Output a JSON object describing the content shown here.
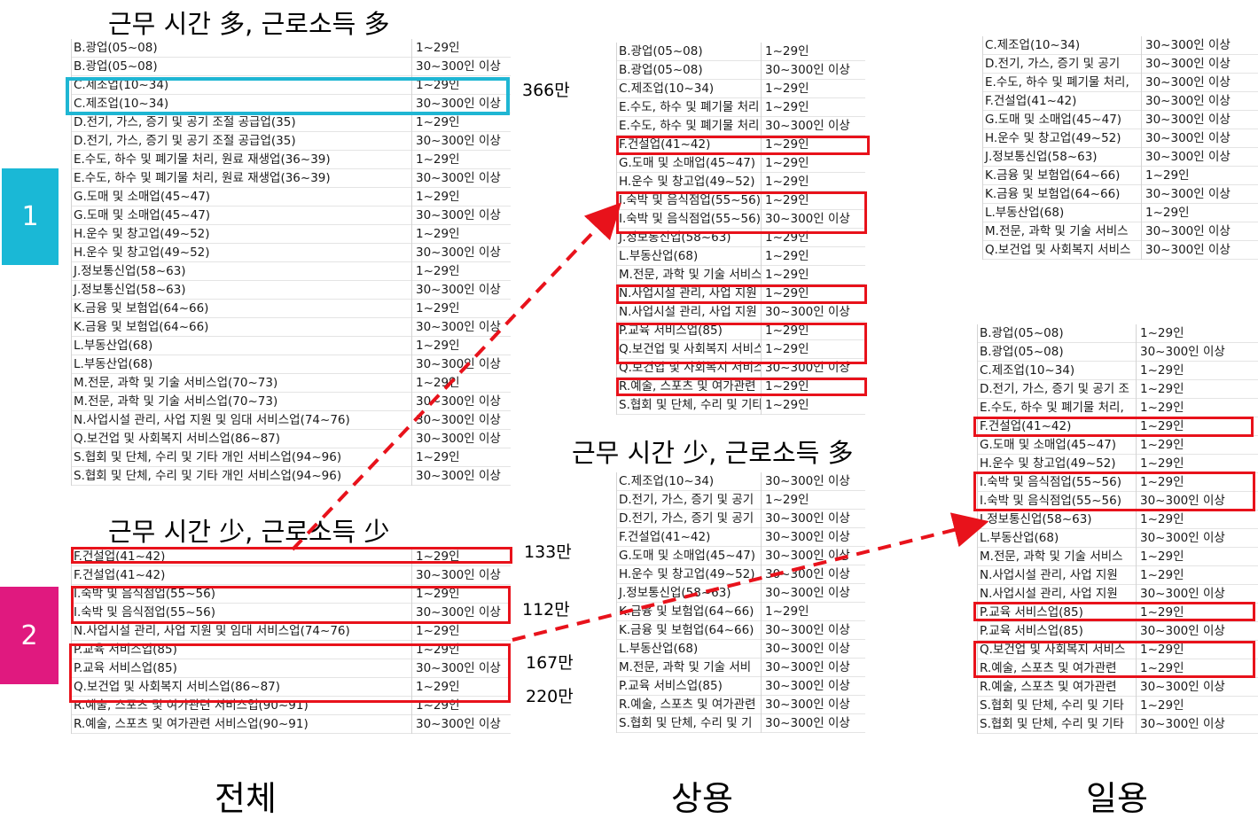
{
  "headings": {
    "top_left": "근무 시간 多, 근로소득 多",
    "bottom_left": "근무 시간 少, 근로소득 少",
    "center": "근무 시간 少, 근로소득 多"
  },
  "badges": {
    "one": {
      "label": "1",
      "color": "#1ab8d6"
    },
    "two": {
      "label": "2",
      "color": "#e0197f"
    }
  },
  "annotations": {
    "a366": "366만",
    "a133": "133만",
    "a112": "112만",
    "a167": "167만",
    "a220": "220만"
  },
  "footer": {
    "total": "전체",
    "regular": "상용",
    "daily": "일용"
  },
  "colors": {
    "highlight_red": "#e8121b",
    "highlight_cyan": "#1fb6d3"
  },
  "tables": {
    "t1": [
      [
        "B.광업(05~08)",
        "1~29인"
      ],
      [
        "B.광업(05~08)",
        "30~300인 이상"
      ],
      [
        "C.제조업(10~34)",
        "1~29인"
      ],
      [
        "C.제조업(10~34)",
        "30~300인 이상"
      ],
      [
        "D.전기, 가스, 증기 및 공기 조절 공급업(35)",
        "1~29인"
      ],
      [
        "D.전기, 가스, 증기 및 공기 조절 공급업(35)",
        "30~300인 이상"
      ],
      [
        "E.수도, 하수 및 폐기물 처리, 원료 재생업(36~39)",
        "1~29인"
      ],
      [
        "E.수도, 하수 및 폐기물 처리, 원료 재생업(36~39)",
        "30~300인 이상"
      ],
      [
        "G.도매 및 소매업(45~47)",
        "1~29인"
      ],
      [
        "G.도매 및 소매업(45~47)",
        "30~300인 이상"
      ],
      [
        "H.운수 및 창고업(49~52)",
        "1~29인"
      ],
      [
        "H.운수 및 창고업(49~52)",
        "30~300인 이상"
      ],
      [
        "J.정보통신업(58~63)",
        "1~29인"
      ],
      [
        "J.정보통신업(58~63)",
        "30~300인 이상"
      ],
      [
        "K.금융 및 보험업(64~66)",
        "1~29인"
      ],
      [
        "K.금융 및 보험업(64~66)",
        "30~300인 이상"
      ],
      [
        "L.부동산업(68)",
        "1~29인"
      ],
      [
        "L.부동산업(68)",
        "30~300인 이상"
      ],
      [
        "M.전문, 과학 및 기술 서비스업(70~73)",
        "1~29인"
      ],
      [
        "M.전문, 과학 및 기술 서비스업(70~73)",
        "30~300인 이상"
      ],
      [
        "N.사업시설 관리, 사업 지원 및 임대 서비스업(74~76)",
        "30~300인 이상"
      ],
      [
        "Q.보건업 및 사회복지 서비스업(86~87)",
        "30~300인 이상"
      ],
      [
        "S.협회 및 단체, 수리 및 기타 개인 서비스업(94~96)",
        "1~29인"
      ],
      [
        "S.협회 및 단체, 수리 및 기타 개인 서비스업(94~96)",
        "30~300인 이상"
      ]
    ],
    "t2": [
      [
        "F.건설업(41~42)",
        "1~29인"
      ],
      [
        "F.건설업(41~42)",
        "30~300인 이상"
      ],
      [
        "I.숙박 및 음식점업(55~56)",
        "1~29인"
      ],
      [
        "I.숙박 및 음식점업(55~56)",
        "30~300인 이상"
      ],
      [
        "N.사업시설 관리, 사업 지원 및 임대 서비스업(74~76)",
        "1~29인"
      ],
      [
        "P.교육 서비스업(85)",
        "1~29인"
      ],
      [
        "P.교육 서비스업(85)",
        "30~300인 이상"
      ],
      [
        "Q.보건업 및 사회복지 서비스업(86~87)",
        "1~29인"
      ],
      [
        "R.예술, 스포츠 및 여가관련 서비스업(90~91)",
        "1~29인"
      ],
      [
        "R.예술, 스포츠 및 여가관련 서비스업(90~91)",
        "30~300인 이상"
      ]
    ],
    "t3": [
      [
        "B.광업(05~08)",
        "1~29인"
      ],
      [
        "B.광업(05~08)",
        "30~300인 이상"
      ],
      [
        "C.제조업(10~34)",
        "1~29인"
      ],
      [
        "E.수도, 하수 및 폐기물 처리",
        "1~29인"
      ],
      [
        "E.수도, 하수 및 폐기물 처리",
        "30~300인 이상"
      ],
      [
        "F.건설업(41~42)",
        "1~29인"
      ],
      [
        "G.도매 및 소매업(45~47)",
        "1~29인"
      ],
      [
        "H.운수 및 창고업(49~52)",
        "1~29인"
      ],
      [
        "I.숙박 및 음식점업(55~56)",
        "1~29인"
      ],
      [
        "I.숙박 및 음식점업(55~56)",
        "30~300인 이상"
      ],
      [
        "J.정보통신업(58~63)",
        "1~29인"
      ],
      [
        "L.부동산업(68)",
        "1~29인"
      ],
      [
        "M.전문, 과학 및 기술 서비스",
        "1~29인"
      ],
      [
        "N.사업시설 관리, 사업 지원",
        "1~29인"
      ],
      [
        "N.사업시설 관리, 사업 지원",
        "30~300인 이상"
      ],
      [
        "P.교육 서비스업(85)",
        "1~29인"
      ],
      [
        "Q.보건업 및 사회복지 서비스",
        "1~29인"
      ],
      [
        "Q.보건업 및 사회복지 서비스",
        "30~300인 이상"
      ],
      [
        "R.예술, 스포츠 및 여가관련",
        "1~29인"
      ],
      [
        "S.협회 및 단체, 수리 및 기타",
        "1~29인"
      ]
    ],
    "t4": [
      [
        "C.제조업(10~34)",
        "30~300인 이상"
      ],
      [
        "D.전기, 가스, 증기 및 공기",
        "1~29인"
      ],
      [
        "D.전기, 가스, 증기 및 공기",
        "30~300인 이상"
      ],
      [
        "F.건설업(41~42)",
        "30~300인 이상"
      ],
      [
        "G.도매 및 소매업(45~47)",
        "30~300인 이상"
      ],
      [
        "H.운수 및 창고업(49~52)",
        "30~300인 이상"
      ],
      [
        "J.정보통신업(58~63)",
        "30~300인 이상"
      ],
      [
        "K.금융 및 보험업(64~66)",
        "1~29인"
      ],
      [
        "K.금융 및 보험업(64~66)",
        "30~300인 이상"
      ],
      [
        "L.부동산업(68)",
        "30~300인 이상"
      ],
      [
        "M.전문, 과학 및 기술 서비",
        "30~300인 이상"
      ],
      [
        "P.교육 서비스업(85)",
        "30~300인 이상"
      ],
      [
        "R.예술, 스포츠 및 여가관련",
        "30~300인 이상"
      ],
      [
        "S.협회 및 단체, 수리 및 기",
        "30~300인 이상"
      ]
    ],
    "t5": [
      [
        "C.제조업(10~34)",
        "30~300인 이상"
      ],
      [
        "D.전기, 가스, 증기 및 공기",
        "30~300인 이상"
      ],
      [
        "E.수도, 하수 및 폐기물 처리,",
        "30~300인 이상"
      ],
      [
        "F.건설업(41~42)",
        "30~300인 이상"
      ],
      [
        "G.도매 및 소매업(45~47)",
        "30~300인 이상"
      ],
      [
        "H.운수 및 창고업(49~52)",
        "30~300인 이상"
      ],
      [
        "J.정보통신업(58~63)",
        "30~300인 이상"
      ],
      [
        "K.금융 및 보험업(64~66)",
        "1~29인"
      ],
      [
        "K.금융 및 보험업(64~66)",
        "30~300인 이상"
      ],
      [
        "L.부동산업(68)",
        "1~29인"
      ],
      [
        "M.전문, 과학 및 기술 서비스",
        "30~300인 이상"
      ],
      [
        "Q.보건업 및 사회복지 서비스",
        "30~300인 이상"
      ]
    ],
    "t6": [
      [
        "B.광업(05~08)",
        "1~29인"
      ],
      [
        "B.광업(05~08)",
        "30~300인 이상"
      ],
      [
        "C.제조업(10~34)",
        "1~29인"
      ],
      [
        "D.전기, 가스, 증기 및 공기 조",
        "1~29인"
      ],
      [
        "E.수도, 하수 및 폐기물 처리,",
        "1~29인"
      ],
      [
        "F.건설업(41~42)",
        "1~29인"
      ],
      [
        "G.도매 및 소매업(45~47)",
        "1~29인"
      ],
      [
        "H.운수 및 창고업(49~52)",
        "1~29인"
      ],
      [
        "I.숙박 및 음식점업(55~56)",
        "1~29인"
      ],
      [
        "I.숙박 및 음식점업(55~56)",
        "30~300인 이상"
      ],
      [
        "J.정보통신업(58~63)",
        "1~29인"
      ],
      [
        "L.부동산업(68)",
        "30~300인 이상"
      ],
      [
        "M.전문, 과학 및 기술 서비스",
        "1~29인"
      ],
      [
        "N.사업시설 관리, 사업 지원",
        "1~29인"
      ],
      [
        "N.사업시설 관리, 사업 지원",
        "30~300인 이상"
      ],
      [
        "P.교육 서비스업(85)",
        "1~29인"
      ],
      [
        "P.교육 서비스업(85)",
        "30~300인 이상"
      ],
      [
        "Q.보건업 및 사회복지 서비스",
        "1~29인"
      ],
      [
        "R.예술, 스포츠 및 여가관련",
        "1~29인"
      ],
      [
        "R.예술, 스포츠 및 여가관련",
        "30~300인 이상"
      ],
      [
        "S.협회 및 단체, 수리 및 기타",
        "1~29인"
      ],
      [
        "S.협회 및 단체, 수리 및 기타",
        "30~300인 이상"
      ]
    ]
  }
}
